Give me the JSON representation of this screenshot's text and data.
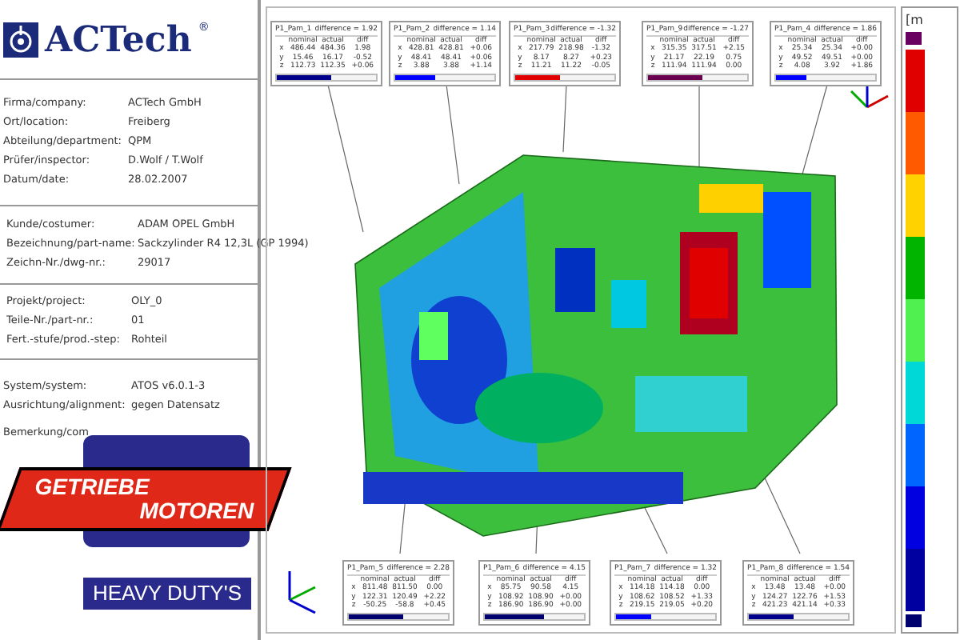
{
  "header": {
    "logo_text": "ACTech",
    "logo_mark": "®"
  },
  "company_info": [
    {
      "label": "Firma/company:",
      "value": "ACTech GmbH"
    },
    {
      "label": "Ort/location:",
      "value": "Freiberg"
    },
    {
      "label": "Abteilung/department:",
      "value": "QPM"
    },
    {
      "label": "Prüfer/inspector:",
      "value": "D.Wolf / T.Wolf"
    },
    {
      "label": "Datum/date:",
      "value": "28.02.2007"
    }
  ],
  "customer_info": [
    {
      "label": "Kunde/costumer:",
      "value": "ADAM OPEL GmbH"
    },
    {
      "label": "Bezeichnung/part-name:",
      "value": "Sackzylinder R4 12,3L (GP 1994)"
    },
    {
      "label": "Zeichn-Nr./dwg-nr.:",
      "value": "29017"
    }
  ],
  "project_info": [
    {
      "label": "Projekt/project:",
      "value": "OLY_0"
    },
    {
      "label": "Teile-Nr./part-nr.:",
      "value": "01"
    },
    {
      "label": "Fert.-stufe/prod.-step:",
      "value": "Rohteil"
    }
  ],
  "system_info": [
    {
      "label": "System/system:",
      "value": "ATOS  v6.0.1-3"
    },
    {
      "label": "Ausrichtung/alignment:",
      "value": "gegen Datensatz"
    }
  ],
  "remark_label": "Bemerkung/com",
  "badge": {
    "line_1": "GETRIEBE",
    "line_2": "MOTOREN",
    "tagline": "HEAVY DUTY'S"
  },
  "top_callouts": [
    {
      "name": "P1_Pam_1",
      "difference": "difference = 1.92",
      "columns": [
        "nominal",
        "actual",
        "diff"
      ],
      "rows": [
        {
          "axis": "x",
          "values": [
            "486.44",
            "484.36",
            "1.98"
          ]
        },
        {
          "axis": "y",
          "values": [
            "15.46",
            "16.17",
            "-0.52"
          ]
        },
        {
          "axis": "z",
          "values": [
            "112.73",
            "112.35",
            "+0.06"
          ]
        }
      ],
      "level": 0.55,
      "color": "#00008b"
    },
    {
      "name": "P1_Pam_2",
      "difference": "difference = 1.14",
      "columns": [
        "nominal",
        "actual",
        "diff"
      ],
      "rows": [
        {
          "axis": "x",
          "values": [
            "428.81",
            "428.81",
            "+0.06"
          ]
        },
        {
          "axis": "y",
          "values": [
            "48.41",
            "48.41",
            "+0.06"
          ]
        },
        {
          "axis": "z",
          "values": [
            "3.88",
            "3.88",
            "+1.14"
          ]
        }
      ],
      "level": 0.4,
      "color": "#0000ff"
    },
    {
      "name": "P1_Pam_3",
      "difference": "difference = -1.32",
      "columns": [
        "nominal",
        "actual",
        "diff"
      ],
      "rows": [
        {
          "axis": "x",
          "values": [
            "217.79",
            "218.98",
            "-1.32"
          ]
        },
        {
          "axis": "y",
          "values": [
            "8.17",
            "8.27",
            "+0.23"
          ]
        },
        {
          "axis": "z",
          "values": [
            "11.21",
            "11.22",
            "-0.05"
          ]
        }
      ],
      "level": 0.45,
      "color": "#e00000"
    },
    {
      "name": "P1_Pam_9",
      "difference": "difference = -1.27",
      "columns": [
        "nominal",
        "actual",
        "diff"
      ],
      "rows": [
        {
          "axis": "x",
          "values": [
            "315.35",
            "317.51",
            "+2.15"
          ]
        },
        {
          "axis": "y",
          "values": [
            "21.17",
            "22.19",
            "0.75"
          ]
        },
        {
          "axis": "z",
          "values": [
            "111.94",
            "111.94",
            "0.00"
          ]
        }
      ],
      "level": 0.55,
      "color": "#6a0050"
    },
    {
      "name": "P1_Pam_4",
      "difference": "difference = 1.86",
      "columns": [
        "nominal",
        "actual",
        "diff"
      ],
      "rows": [
        {
          "axis": "x",
          "values": [
            "25.34",
            "25.34",
            "+0.00"
          ]
        },
        {
          "axis": "y",
          "values": [
            "49.52",
            "49.51",
            "+0.00"
          ]
        },
        {
          "axis": "z",
          "values": [
            "4.08",
            "3.92",
            "+1.86"
          ]
        }
      ],
      "level": 0.3,
      "color": "#0000ff"
    }
  ],
  "bottom_callouts": [
    {
      "name": "P1_Pam_5",
      "difference": "difference = 2.28",
      "columns": [
        "nominal",
        "actual",
        "diff"
      ],
      "rows": [
        {
          "axis": "x",
          "values": [
            "811.48",
            "811.50",
            "0.00"
          ]
        },
        {
          "axis": "y",
          "values": [
            "122.31",
            "120.49",
            "+2.22"
          ]
        },
        {
          "axis": "z",
          "values": [
            "-50.25",
            "-58.8",
            "+0.45"
          ]
        }
      ],
      "level": 0.55,
      "color": "#00006e"
    },
    {
      "name": "P1_Pam_6",
      "difference": "difference = 4.15",
      "columns": [
        "nominal",
        "actual",
        "diff"
      ],
      "rows": [
        {
          "axis": "x",
          "values": [
            "85.75",
            "90.58",
            "4.15"
          ]
        },
        {
          "axis": "y",
          "values": [
            "108.92",
            "108.90",
            "+0.00"
          ]
        },
        {
          "axis": "z",
          "values": [
            "186.90",
            "186.90",
            "+0.00"
          ]
        }
      ],
      "level": 0.6,
      "color": "#00006e"
    },
    {
      "name": "P1_Pam_7",
      "difference": "difference = 1.32",
      "columns": [
        "nominal",
        "actual",
        "diff"
      ],
      "rows": [
        {
          "axis": "x",
          "values": [
            "114.18",
            "114.18",
            "0.00"
          ]
        },
        {
          "axis": "y",
          "values": [
            "108.62",
            "108.52",
            "+1.33"
          ]
        },
        {
          "axis": "z",
          "values": [
            "219.15",
            "219.05",
            "+0.20"
          ]
        }
      ],
      "level": 0.35,
      "color": "#0000ff"
    },
    {
      "name": "P1_Pam_8",
      "difference": "difference = 1.54",
      "columns": [
        "nominal",
        "actual",
        "diff"
      ],
      "rows": [
        {
          "axis": "x",
          "values": [
            "13.48",
            "13.48",
            "+0.00"
          ]
        },
        {
          "axis": "y",
          "values": [
            "124.27",
            "122.76",
            "+1.53"
          ]
        },
        {
          "axis": "z",
          "values": [
            "421.23",
            "421.14",
            "+0.33"
          ]
        }
      ],
      "level": 0.45,
      "color": "#00008b"
    }
  ],
  "legend": {
    "unit": "[m",
    "bands": [
      {
        "kind": "swatch",
        "color": "#6a0060"
      },
      {
        "kind": "band",
        "color": "#e00000"
      },
      {
        "kind": "band",
        "color": "#ff5a00"
      },
      {
        "kind": "band",
        "color": "#ffd200"
      },
      {
        "kind": "band",
        "color": "#00b400"
      },
      {
        "kind": "band",
        "color": "#50f050"
      },
      {
        "kind": "band",
        "color": "#00d8d8"
      },
      {
        "kind": "band",
        "color": "#0064ff"
      },
      {
        "kind": "band",
        "color": "#0000e0"
      },
      {
        "kind": "band",
        "color": "#0000a0"
      },
      {
        "kind": "swatch",
        "color": "#00006e"
      }
    ]
  }
}
